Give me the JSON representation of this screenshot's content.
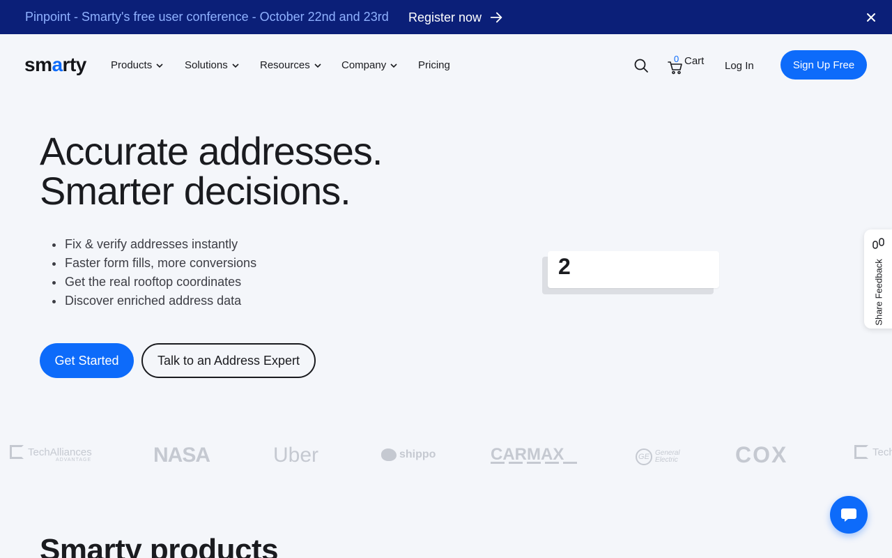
{
  "announcement": {
    "message": "Pinpoint - Smarty's free user conference - October 22nd and 23rd",
    "cta": "Register now"
  },
  "nav": {
    "logo_prefix": "sm",
    "logo_accent": "a",
    "logo_suffix": "rty",
    "items": [
      {
        "label": "Products"
      },
      {
        "label": "Solutions"
      },
      {
        "label": "Resources"
      },
      {
        "label": "Company"
      },
      {
        "label": "Pricing"
      }
    ],
    "cart_count": "0",
    "cart_label": "Cart",
    "login_label": "Log In",
    "signup_label": "Sign Up Free"
  },
  "hero": {
    "title_line1": "Accurate addresses.",
    "title_line2": "Smarter decisions.",
    "bullets": [
      "Fix & verify addresses instantly",
      "Faster form fills, more conversions",
      "Get the real rooftop coordinates",
      "Discover enriched address data"
    ],
    "primary_cta": "Get Started",
    "secondary_cta": "Talk to an Address Expert",
    "card_value": "2"
  },
  "feedback": {
    "label": "Share Feedback"
  },
  "logos": {
    "techalliances": "TechAlliances",
    "techalliances_sub": "ADVANTAGE",
    "nasa": "NASA",
    "uber": "Uber",
    "shippo": "shippo",
    "carmax": "CARMAX",
    "ge_mark": "GE",
    "ge_line1": "General",
    "ge_line2": "Electric",
    "cox": "COX",
    "tech_partial": "Tech"
  },
  "products": {
    "heading": "Smarty products"
  },
  "colors": {
    "brand_blue": "#0d6bfa",
    "banner_bg": "#0b1f78",
    "banner_text": "#8fb1ff",
    "page_bg": "#f4f6fa"
  }
}
